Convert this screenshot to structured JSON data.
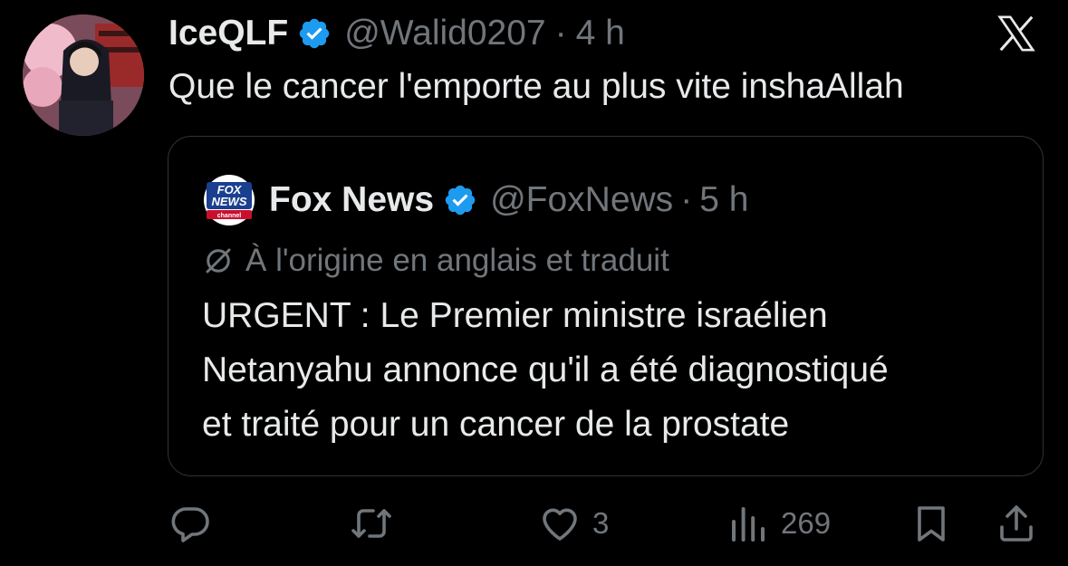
{
  "author": {
    "display_name": "IceQLF",
    "handle": "@Walid0207",
    "separator": "·",
    "time": "4 h",
    "avatar_icon": "anime-avatar"
  },
  "tweet": {
    "text": "Que le cancer l'emporte au plus vite inshaAllah"
  },
  "quoted": {
    "display_name": "Fox News",
    "handle": "@FoxNews",
    "separator": "·",
    "time": "5 h",
    "logo_lines": [
      "FOX",
      "NEWS",
      "channel"
    ],
    "translation_note": "À l'origine en anglais et traduit",
    "body_lines": [
      "URGENT : Le Premier ministre israélien",
      "Netanyahu annonce qu'il a été diagnostiqué",
      "et traité pour un cancer de la prostate"
    ]
  },
  "actions": {
    "reply_count": "",
    "retweet_count": "",
    "like_count": "3",
    "views_count": "269"
  },
  "colors": {
    "background": "#000000",
    "text_primary": "#e7e9ea",
    "text_secondary": "#71767b",
    "verified_blue": "#1d9bf0",
    "border": "#2f3336",
    "fox_blue": "#1b3f8f",
    "fox_red": "#c8102e"
  }
}
